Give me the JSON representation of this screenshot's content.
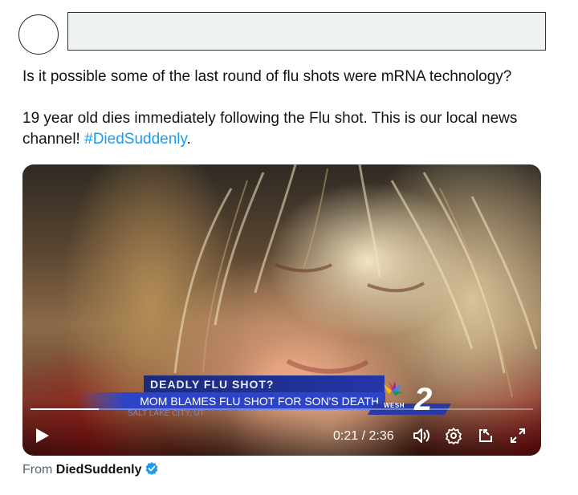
{
  "tweet": {
    "line1": "Is it possible some of the last round of flu shots were mRNA technology?",
    "line2_text": "19 year old dies immediately following the Flu shot. This is our local news channel! ",
    "hashtag": "#DiedSuddenly",
    "line2_end": "."
  },
  "video": {
    "chyron_headline": "DEADLY FLU SHOT?",
    "chyron_main": "MOM BLAMES FLU SHOT FOR SON'S DEATH",
    "chyron_location": "SALT LAKE CITY, UT",
    "station_label": "WESH",
    "progress": 0.136,
    "time_display": "0:21 / 2:36"
  },
  "source": {
    "prefix": "From",
    "name": "DiedSuddenly"
  },
  "colors": {
    "hashtag": "#1d9bf0",
    "verified": "#1d9bf0"
  }
}
